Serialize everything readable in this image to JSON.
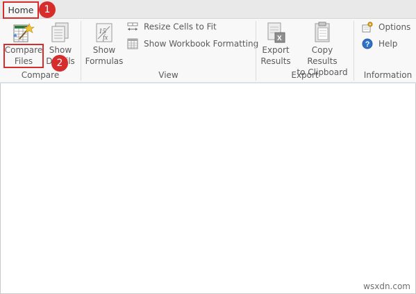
{
  "tabs": [
    {
      "label": "Home"
    }
  ],
  "groups": {
    "compare": {
      "label": "Compare",
      "buttons": {
        "compare_files": {
          "line1": "Compare",
          "line2": "Files"
        },
        "show_details": {
          "line1": "Show",
          "line2": "Details"
        }
      }
    },
    "view": {
      "label": "View",
      "show_formulas": {
        "line1": "Show",
        "line2": "Formulas"
      },
      "resize_cells": "Resize Cells to Fit",
      "show_workbook_formatting": "Show Workbook Formatting"
    },
    "export": {
      "label": "Export",
      "export_results": {
        "line1": "Export",
        "line2": "Results"
      },
      "copy_results": {
        "line1": "Copy Results",
        "line2": "to Clipboard"
      }
    },
    "information": {
      "label": "Information",
      "options": "Options",
      "help": "Help"
    }
  },
  "annotations": {
    "step1": "1",
    "step2": "2"
  },
  "watermark": "wsxdn.com",
  "colors": {
    "highlight": "#d62c2c",
    "ribbon_bg": "#f8f8f8",
    "tab_strip_bg": "#e9e9e9"
  }
}
